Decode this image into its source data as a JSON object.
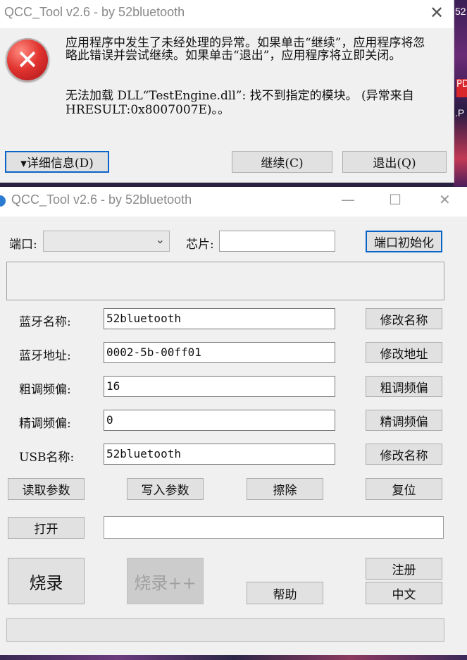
{
  "background": {
    "right_fragments": [
      "52",
      "PD",
      ".P"
    ]
  },
  "error_dialog": {
    "title": "QCC_Tool v2.6 - by 52bluetooth",
    "close_glyph": "✕",
    "icon": "error-icon",
    "message_line1": "应用程序中发生了未经处理的异常。如果单击“继续”，应用程序将忽略此错误并尝试继续。如果单击“退出”，应用程序将立即关闭。",
    "message_line2": "无法加载 DLL“TestEngine.dll”: 找不到指定的模块。 (异常来自 HRESULT:0x8007007E)。。",
    "details_button": "▾详细信息(D)",
    "continue_button": "继续(C)",
    "quit_button": "退出(Q)"
  },
  "main_window": {
    "title": "QCC_Tool v2.6 - by 52bluetooth",
    "minimize_glyph": "—",
    "maximize_glyph": "☐",
    "close_glyph": "✕",
    "port_label": "端口:",
    "port_value": "",
    "chip_label": "芯片:",
    "chip_value": "",
    "init_port_button": "端口初始化",
    "fields": [
      {
        "label": "蓝牙名称:",
        "value": "52bluetooth",
        "button": "修改名称"
      },
      {
        "label": "蓝牙地址:",
        "value": "0002-5b-00ff01",
        "button": "修改地址"
      },
      {
        "label": "粗调频偏:",
        "value": "16",
        "button": "粗调频偏"
      },
      {
        "label": "精调频偏:",
        "value": "0",
        "button": "精调频偏"
      },
      {
        "label": "USB名称:",
        "value": "52bluetooth",
        "button": "修改名称"
      }
    ],
    "read_params_button": "读取参数",
    "write_params_button": "写入参数",
    "erase_button": "擦除",
    "reset_button": "复位",
    "open_button": "打开",
    "open_path": "",
    "burn_button": "烧录",
    "burn_plus_button": "烧录++",
    "help_button": "帮助",
    "register_button": "注册",
    "chinese_button": "中文",
    "progress": 0
  }
}
